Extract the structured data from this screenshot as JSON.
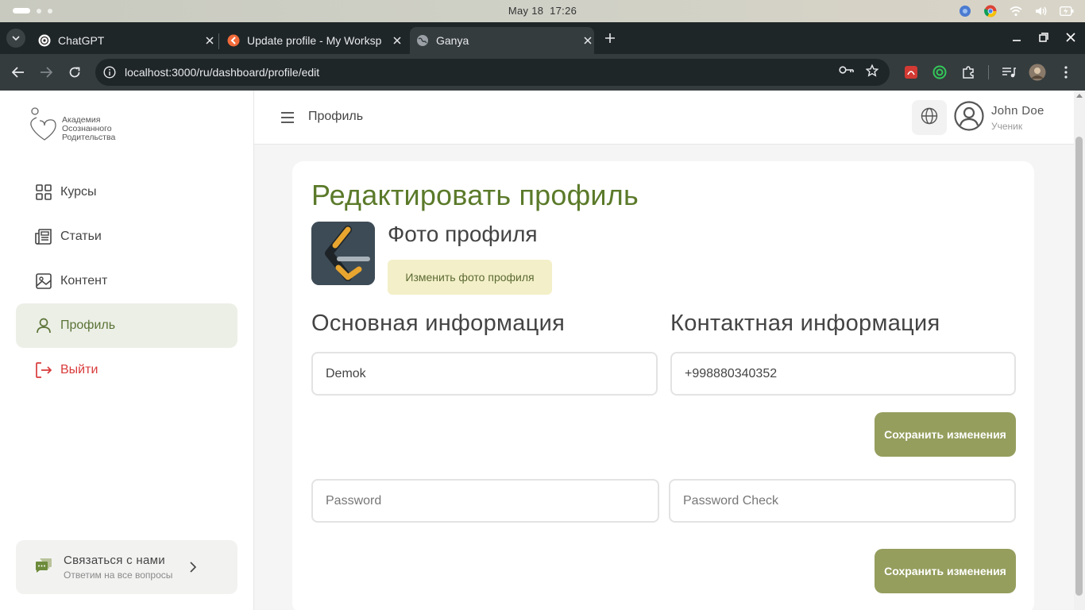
{
  "os": {
    "date": "May 18",
    "time": "17:26"
  },
  "browser": {
    "tabs": [
      {
        "title": "ChatGPT",
        "active": false
      },
      {
        "title": "Update profile - My Worksp",
        "active": false
      },
      {
        "title": "Ganya",
        "active": true
      }
    ],
    "url": "localhost:3000/ru/dashboard/profile/edit"
  },
  "sidebar": {
    "logo_lines": [
      "Академия",
      "Осознанного",
      "Родительства"
    ],
    "items": [
      {
        "label": "Курсы",
        "icon": "grid-icon"
      },
      {
        "label": "Статьи",
        "icon": "newspaper-icon"
      },
      {
        "label": "Контент",
        "icon": "image-icon"
      },
      {
        "label": "Профиль",
        "icon": "user-icon",
        "active": true
      },
      {
        "label": "Выйти",
        "icon": "logout-icon"
      }
    ],
    "contact": {
      "title": "Связаться с нами",
      "subtitle": "Ответим на все вопросы"
    }
  },
  "topbar": {
    "title": "Профиль",
    "user_name": "John Doe",
    "user_role": "Ученик"
  },
  "profile": {
    "heading": "Редактировать профиль",
    "photo_title": "Фото профиля",
    "change_photo_label": "Изменить фото профиля",
    "basic_info_title": "Основная информация",
    "contact_info_title": "Контактная информация",
    "name_value": "Demok",
    "phone_value": "+998880340352",
    "save_label": "Сохранить изменения",
    "password_placeholder": "Password",
    "password_check_placeholder": "Password Check",
    "save_label_2": "Сохранить изменения"
  },
  "colors": {
    "accent_green": "#5b7a2a",
    "save_button": "#959e5d",
    "change_photo_bg": "#f3efc8",
    "logout_red": "#d93a3a",
    "active_nav_bg": "#ecefe6"
  }
}
